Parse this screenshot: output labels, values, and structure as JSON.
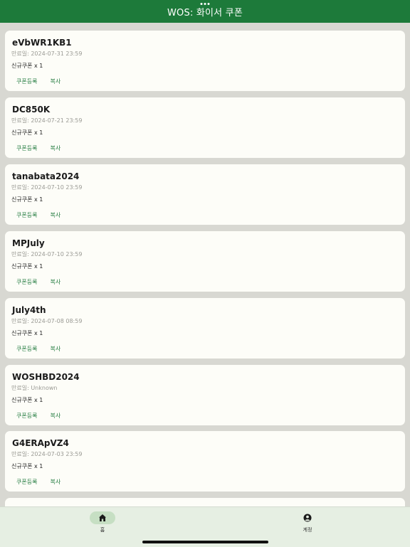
{
  "header": {
    "title": "WOS: 화이서 쿠폰"
  },
  "coupons": [
    {
      "code": "eVbWR1KB1",
      "expire": "만료일: 2024-07-31 23:59",
      "reward": "신규쿠폰 x 1",
      "register_label": "쿠폰등록",
      "copy_label": "복사"
    },
    {
      "code": "DC850K",
      "expire": "만료일: 2024-07-21 23:59",
      "reward": "신규쿠폰 x 1",
      "register_label": "쿠폰등록",
      "copy_label": "복사"
    },
    {
      "code": "tanabata2024",
      "expire": "만료일: 2024-07-10 23:59",
      "reward": "신규쿠폰 x 1",
      "register_label": "쿠폰등록",
      "copy_label": "복사"
    },
    {
      "code": "MPJuly",
      "expire": "만료일: 2024-07-10 23:59",
      "reward": "신규쿠폰 x 1",
      "register_label": "쿠폰등록",
      "copy_label": "복사"
    },
    {
      "code": "July4th",
      "expire": "만료일: 2024-07-08 08:59",
      "reward": "신규쿠폰 x 1",
      "register_label": "쿠폰등록",
      "copy_label": "복사"
    },
    {
      "code": "WOSHBD2024",
      "expire": "만료일: Unknown",
      "reward": "신규쿠폰 x 1",
      "register_label": "쿠폰등록",
      "copy_label": "복사"
    },
    {
      "code": "G4ERApVZ4",
      "expire": "만료일: 2024-07-03 23:59",
      "reward": "신규쿠폰 x 1",
      "register_label": "쿠폰등록",
      "copy_label": "복사"
    }
  ],
  "tabs": [
    {
      "label": "홈",
      "icon": "home-icon",
      "active": true
    },
    {
      "label": "계정",
      "icon": "account-icon",
      "active": false
    }
  ],
  "colors": {
    "header": "#1d7a3a",
    "accent": "#217a3e",
    "background": "#d8d8d2",
    "card": "#fdfdf8",
    "tabbar": "#e6efe3"
  }
}
